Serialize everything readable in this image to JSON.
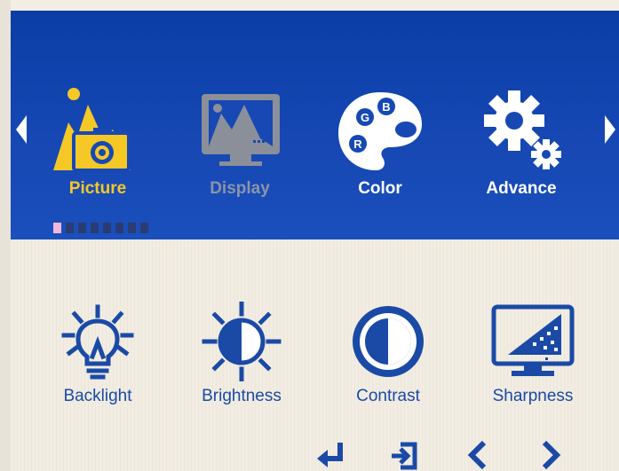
{
  "categories": [
    {
      "label": "Picture",
      "icon": "picture-icon",
      "state": "active"
    },
    {
      "label": "Display",
      "icon": "display-icon",
      "state": "disabled"
    },
    {
      "label": "Color",
      "icon": "color-palette-icon",
      "state": "normal"
    },
    {
      "label": "Advance",
      "icon": "advance-gear-icon",
      "state": "normal"
    }
  ],
  "palette_letters": {
    "g": "G",
    "b": "B",
    "r": "R"
  },
  "page_indicator": {
    "total": 8,
    "current": 1
  },
  "items": [
    {
      "label": "Backlight",
      "icon": "backlight-bulb-icon"
    },
    {
      "label": "Brightness",
      "icon": "brightness-sun-icon"
    },
    {
      "label": "Contrast",
      "icon": "contrast-icon"
    },
    {
      "label": "Sharpness",
      "icon": "sharpness-monitor-icon"
    }
  ],
  "keys": [
    "enter-icon",
    "exit-icon",
    "chevron-left-icon",
    "chevron-right-icon"
  ],
  "colors": {
    "header_blue": "#1748b4",
    "active_yellow": "#f5c826",
    "item_blue": "#1a4aa6",
    "disabled_gray": "#8b95a8"
  }
}
